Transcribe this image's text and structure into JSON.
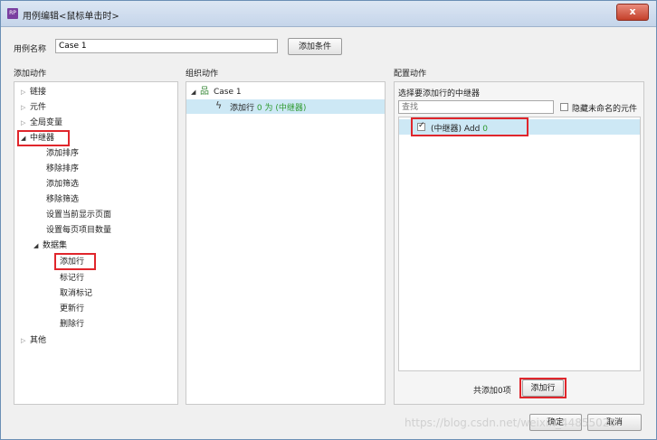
{
  "window": {
    "title": "用例编辑<鼠标单击时>",
    "app_icon": "RP",
    "close_symbol": "x"
  },
  "case_name": {
    "label": "用例名称",
    "value": "Case 1",
    "add_condition_label": "添加条件"
  },
  "add_action": {
    "header": "添加动作",
    "items": {
      "link": "链接",
      "widget": "元件",
      "global_var": "全局变量",
      "repeater": "中继器",
      "add_sort": "添加排序",
      "remove_sort": "移除排序",
      "add_filter": "添加筛选",
      "remove_filter": "移除筛选",
      "set_page": "设置当前显示页面",
      "set_items_per_page": "设置每页项目数量",
      "dataset": "数据集",
      "add_row": "添加行",
      "mark_row": "标记行",
      "unmark": "取消标记",
      "update_row": "更新行",
      "delete_row": "删除行",
      "other": "其他"
    }
  },
  "organize_action": {
    "header": "组织动作",
    "case_label": "Case 1",
    "action_prefix": "添加行",
    "action_count": "0 为 (中继器)"
  },
  "config_action": {
    "header": "配置动作",
    "choose_label": "选择要添加行的中继器",
    "search_placeholder": "查找",
    "hide_unnamed_label": "隐藏未命名的元件",
    "repeater_item": "(中继器) Add",
    "repeater_item_count": "0",
    "added_count_text": "共添加0项",
    "add_row_button": "添加行"
  },
  "footer": {
    "ok_label": "确定",
    "cancel_label": "取消",
    "watermark": "https://blog.csdn.net/weixin_44855020"
  },
  "colors": {
    "highlight": "#e0262c",
    "selection": "#cde8f5",
    "green_text": "#2f9a2f",
    "titlebar": "#c5d5ea"
  }
}
